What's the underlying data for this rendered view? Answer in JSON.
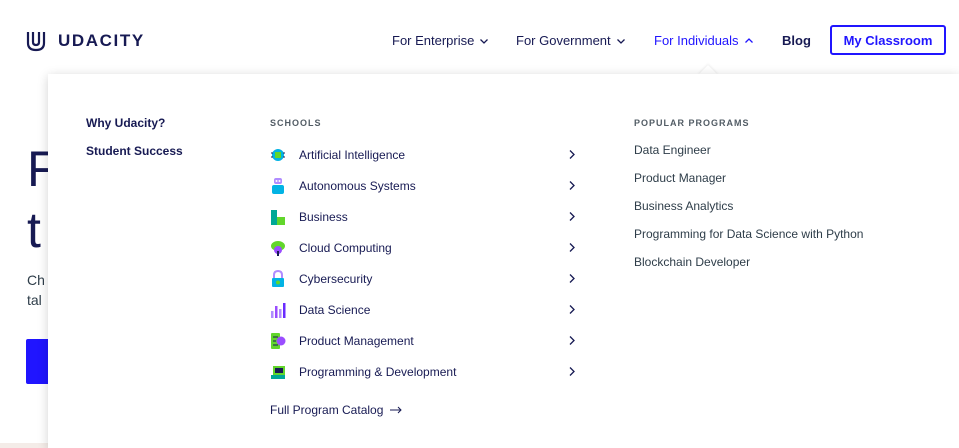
{
  "header": {
    "brand": "UDACITY",
    "nav": [
      {
        "label": "For Enterprise"
      },
      {
        "label": "For Government"
      },
      {
        "label": "For Individuals"
      },
      {
        "label": "Blog"
      }
    ],
    "classroom_button": "My Classroom"
  },
  "hero": {
    "line1": "F",
    "line2": "t",
    "line3": "Ch",
    "line4": "tal"
  },
  "dropdown": {
    "left_links": [
      "Why Udacity?",
      "Student Success"
    ],
    "schools_heading": "SCHOOLS",
    "schools": [
      {
        "label": "Artificial Intelligence",
        "icon": "ai-chip-icon"
      },
      {
        "label": "Autonomous Systems",
        "icon": "robot-icon"
      },
      {
        "label": "Business",
        "icon": "business-icon"
      },
      {
        "label": "Cloud Computing",
        "icon": "cloud-icon"
      },
      {
        "label": "Cybersecurity",
        "icon": "lock-icon"
      },
      {
        "label": "Data Science",
        "icon": "bar-chart-icon"
      },
      {
        "label": "Product Management",
        "icon": "checklist-icon"
      },
      {
        "label": "Programming & Development",
        "icon": "laptop-icon"
      }
    ],
    "catalog_link": "Full Program Catalog",
    "programs_heading": "POPULAR PROGRAMS",
    "programs": [
      "Data Engineer",
      "Product Manager",
      "Business Analytics",
      "Programming for Data Science with Python",
      "Blockchain Developer"
    ]
  },
  "colors": {
    "brand_navy": "#171a53",
    "accent_blue": "#2015ff",
    "muted_text": "#525c65"
  }
}
